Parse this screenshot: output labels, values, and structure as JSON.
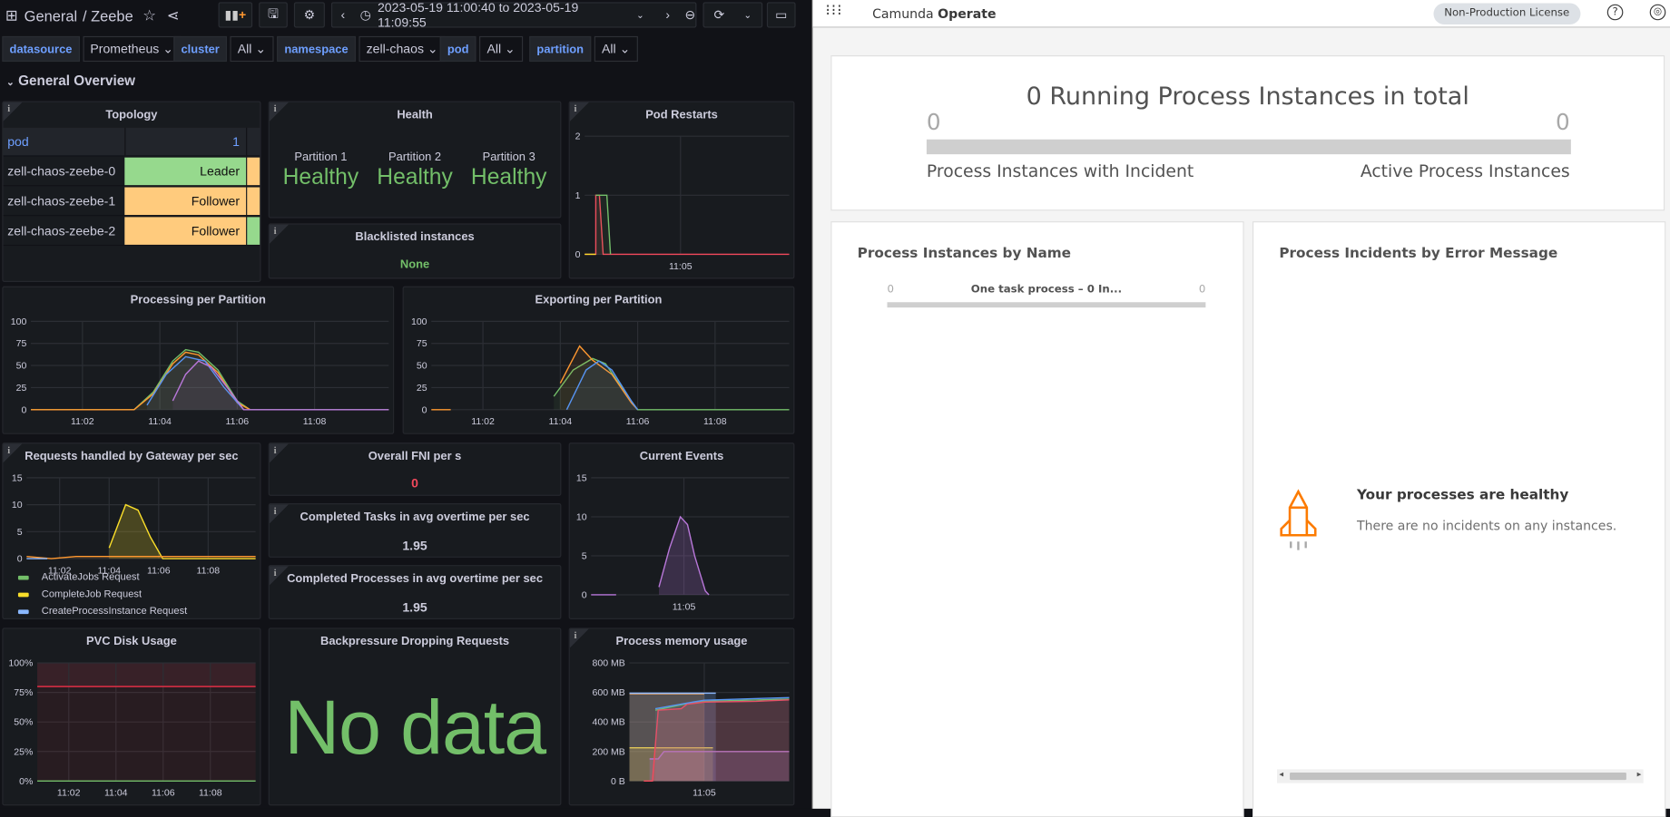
{
  "grafana": {
    "breadcrumb": {
      "folder": "General",
      "dashboard": "/ Zeebe"
    },
    "time_range": "2023-05-19 11:00:40 to 2023-05-19 11:09:55",
    "variables": [
      {
        "label": "datasource",
        "value": "Prometheus"
      },
      {
        "label": "cluster",
        "value": "All"
      },
      {
        "label": "namespace",
        "value": "zell-chaos"
      },
      {
        "label": "pod",
        "value": "All"
      },
      {
        "label": "partition",
        "value": "All"
      }
    ],
    "row_title": "General Overview",
    "topology": {
      "title": "Topology",
      "header": {
        "col1": "pod",
        "col2": "1"
      },
      "rows": [
        {
          "pod": "zell-chaos-zeebe-0",
          "role": "Leader",
          "role_color": "#96d98d",
          "extra_color": "#ffcb7d"
        },
        {
          "pod": "zell-chaos-zeebe-1",
          "role": "Follower",
          "role_color": "#ffcb7d",
          "extra_color": "#ffcb7d"
        },
        {
          "pod": "zell-chaos-zeebe-2",
          "role": "Follower",
          "role_color": "#ffcb7d",
          "extra_color": "#96d98d"
        }
      ]
    },
    "health": {
      "title": "Health",
      "partitions": [
        {
          "label": "Partition 1",
          "status": "Healthy"
        },
        {
          "label": "Partition 2",
          "status": "Healthy"
        },
        {
          "label": "Partition 3",
          "status": "Healthy"
        }
      ],
      "color": "#73bf69"
    },
    "blacklisted": {
      "title": "Blacklisted instances",
      "value": "None"
    },
    "fni": {
      "title": "Overall FNI per s",
      "value": "0",
      "color": "#f2495c"
    },
    "completed_tasks": {
      "title": "Completed Tasks in avg overtime per sec",
      "value": "1.95"
    },
    "completed_processes": {
      "title": "Completed Processes in avg overtime per sec",
      "value": "1.95"
    },
    "backpressure": {
      "title": "Backpressure Dropping Requests",
      "value": "No data"
    },
    "requests_legend": [
      {
        "name": "ActivateJobs Request",
        "color": "#73bf69"
      },
      {
        "name": "CompleteJob Request",
        "color": "#fade2a"
      },
      {
        "name": "CreateProcessInstance Request",
        "color": "#8ab8ff"
      }
    ]
  },
  "chart_data": [
    {
      "id": "pod_restarts",
      "title": "Pod Restarts",
      "type": "line",
      "xrange": [
        "11:00:40",
        "11:09:55"
      ],
      "ylim": [
        0,
        2
      ],
      "yticks": [
        "0",
        "1",
        "2"
      ],
      "ytick_values": [
        0,
        1,
        2
      ],
      "xticks": [
        "11:05"
      ],
      "series": [
        {
          "color": "#f2495c",
          "points": [
            [
              "11:00:40",
              0
            ],
            [
              "11:01:10",
              0
            ],
            [
              "11:01:10",
              1
            ],
            [
              "11:01:20",
              1
            ],
            [
              "11:01:30",
              0
            ],
            [
              "11:09:55",
              0
            ]
          ]
        },
        {
          "color": "#73bf69",
          "points": [
            [
              "11:01:10",
              1
            ],
            [
              "11:01:40",
              1
            ],
            [
              "11:01:50",
              0
            ]
          ]
        },
        {
          "color": "#fade2a",
          "points": [
            [
              "11:00:40",
              0
            ],
            [
              "11:01:10",
              0
            ]
          ]
        }
      ]
    },
    {
      "id": "processing",
      "title": "Processing per Partition",
      "type": "line",
      "xrange": [
        "11:00:40",
        "11:09:55"
      ],
      "ylim": [
        0,
        100
      ],
      "yticks": [
        "0",
        "25",
        "50",
        "75",
        "100"
      ],
      "ytick_values": [
        0,
        25,
        50,
        75,
        100
      ],
      "xticks": [
        "11:02",
        "11:04",
        "11:06",
        "11:08"
      ],
      "series": [
        {
          "color": "#73bf69",
          "points": [
            [
              "11:00:40",
              0
            ],
            [
              "11:03:20",
              0
            ],
            [
              "11:03:50",
              20
            ],
            [
              "11:04:20",
              55
            ],
            [
              "11:04:40",
              68
            ],
            [
              "11:05:00",
              65
            ],
            [
              "11:05:30",
              45
            ],
            [
              "11:06:00",
              10
            ],
            [
              "11:06:20",
              0
            ],
            [
              "11:09:55",
              0
            ]
          ]
        },
        {
          "color": "#ff9830",
          "points": [
            [
              "11:00:40",
              0
            ],
            [
              "11:03:20",
              0
            ],
            [
              "11:03:50",
              18
            ],
            [
              "11:04:20",
              52
            ],
            [
              "11:04:40",
              65
            ],
            [
              "11:05:00",
              62
            ],
            [
              "11:05:30",
              42
            ],
            [
              "11:06:00",
              8
            ],
            [
              "11:06:20",
              0
            ]
          ]
        },
        {
          "color": "#5794f2",
          "points": [
            [
              "11:03:40",
              5
            ],
            [
              "11:04:10",
              40
            ],
            [
              "11:04:40",
              60
            ],
            [
              "11:05:10",
              55
            ],
            [
              "11:05:40",
              25
            ],
            [
              "11:06:10",
              0
            ]
          ]
        },
        {
          "color": "#b877d9",
          "points": [
            [
              "11:04:20",
              10
            ],
            [
              "11:04:40",
              40
            ],
            [
              "11:05:00",
              55
            ],
            [
              "11:05:20",
              48
            ],
            [
              "11:05:50",
              20
            ],
            [
              "11:06:10",
              0
            ],
            [
              "11:09:55",
              0
            ]
          ]
        }
      ]
    },
    {
      "id": "exporting",
      "title": "Exporting per Partition",
      "type": "line",
      "xrange": [
        "11:00:40",
        "11:09:55"
      ],
      "ylim": [
        0,
        100
      ],
      "yticks": [
        "0",
        "25",
        "50",
        "75",
        "100"
      ],
      "ytick_values": [
        0,
        25,
        50,
        75,
        100
      ],
      "xticks": [
        "11:02",
        "11:04",
        "11:06",
        "11:08"
      ],
      "series": [
        {
          "color": "#ff9830",
          "points": [
            [
              "11:00:40",
              0
            ],
            [
              "11:01:10",
              0
            ]
          ]
        },
        {
          "color": "#73bf69",
          "points": [
            [
              "11:03:50",
              15
            ],
            [
              "11:04:20",
              45
            ],
            [
              "11:04:50",
              58
            ],
            [
              "11:05:10",
              52
            ],
            [
              "11:05:40",
              20
            ],
            [
              "11:06:00",
              0
            ],
            [
              "11:09:55",
              0
            ]
          ]
        },
        {
          "color": "#ff9830",
          "points": [
            [
              "11:04:00",
              30
            ],
            [
              "11:04:30",
              72
            ],
            [
              "11:04:50",
              56
            ],
            [
              "11:05:20",
              40
            ],
            [
              "11:05:50",
              8
            ],
            [
              "11:06:00",
              0
            ]
          ]
        },
        {
          "color": "#5794f2",
          "points": [
            [
              "11:04:10",
              0
            ],
            [
              "11:04:40",
              45
            ],
            [
              "11:05:00",
              55
            ],
            [
              "11:05:20",
              45
            ],
            [
              "11:05:50",
              10
            ],
            [
              "11:06:00",
              0
            ]
          ]
        }
      ]
    },
    {
      "id": "requests",
      "title": "Requests handled by Gateway per sec",
      "type": "line",
      "xrange": [
        "11:00:40",
        "11:09:55"
      ],
      "ylim": [
        0,
        15
      ],
      "yticks": [
        "0",
        "5",
        "10",
        "15"
      ],
      "ytick_values": [
        0,
        5,
        10,
        15
      ],
      "xticks": [
        "11:02",
        "11:04",
        "11:06",
        "11:08"
      ],
      "series": [
        {
          "color": "#fade2a",
          "fill": true,
          "points": [
            [
              "11:04:00",
              2
            ],
            [
              "11:04:40",
              10
            ],
            [
              "11:05:10",
              9
            ],
            [
              "11:05:40",
              4
            ],
            [
              "11:06:10",
              0
            ],
            [
              "11:09:55",
              0
            ]
          ]
        },
        {
          "color": "#ff9830",
          "points": [
            [
              "11:00:40",
              0.4
            ],
            [
              "11:01:40",
              0
            ],
            [
              "11:02:40",
              0.4
            ],
            [
              "11:09:55",
              0.4
            ]
          ]
        },
        {
          "color": "#8ab8ff",
          "points": [
            [
              "11:00:40",
              0
            ],
            [
              "11:01:30",
              0
            ]
          ]
        }
      ]
    },
    {
      "id": "current_events",
      "title": "Current Events",
      "type": "line",
      "xrange": [
        "11:00:40",
        "11:09:55"
      ],
      "ylim": [
        0,
        15
      ],
      "yticks": [
        "0",
        "5",
        "10",
        "15"
      ],
      "ytick_values": [
        0,
        5,
        10,
        15
      ],
      "xticks": [
        "11:05"
      ],
      "series": [
        {
          "color": "#b877d9",
          "points": [
            [
              "11:00:40",
              0
            ],
            [
              "11:01:50",
              0
            ]
          ]
        },
        {
          "color": "#b877d9",
          "fill": true,
          "points": [
            [
              "11:03:50",
              1
            ],
            [
              "11:04:20",
              6
            ],
            [
              "11:04:50",
              10
            ],
            [
              "11:05:10",
              9
            ],
            [
              "11:05:30",
              5
            ],
            [
              "11:06:00",
              0.5
            ],
            [
              "11:06:10",
              0
            ]
          ]
        }
      ]
    },
    {
      "id": "pvc",
      "title": "PVC Disk Usage",
      "type": "line",
      "xrange": [
        "11:00:40",
        "11:09:55"
      ],
      "ylim": [
        0,
        100
      ],
      "yticks": [
        "0%",
        "25%",
        "50%",
        "75%",
        "100%"
      ],
      "ytick_values": [
        0,
        25,
        50,
        75,
        100
      ],
      "xticks": [
        "11:02",
        "11:04",
        "11:06",
        "11:08"
      ],
      "threshold_band": {
        "from": 80,
        "to": 100,
        "color": "#f2495c"
      },
      "series": [
        {
          "color": "#e02f44",
          "points": [
            [
              "11:00:40",
              80
            ],
            [
              "11:09:55",
              80
            ]
          ]
        },
        {
          "color": "#73bf69",
          "points": [
            [
              "11:00:40",
              0
            ],
            [
              "11:09:55",
              0
            ]
          ]
        }
      ]
    },
    {
      "id": "memory",
      "title": "Process memory usage",
      "type": "line",
      "xrange": [
        "11:00:40",
        "11:09:55"
      ],
      "ylim": [
        0,
        800
      ],
      "yticks": [
        "0 B",
        "200 MB",
        "400 MB",
        "600 MB",
        "800 MB"
      ],
      "ytick_values": [
        0,
        200,
        400,
        600,
        800
      ],
      "xticks": [
        "11:05"
      ],
      "series": [
        {
          "color": "#fade2a",
          "fill": true,
          "points": [
            [
              "11:00:40",
              225
            ],
            [
              "11:05:30",
              225
            ]
          ]
        },
        {
          "color": "#ff9830",
          "fill": true,
          "points": [
            [
              "11:00:40",
              590
            ],
            [
              "11:05:00",
              590
            ]
          ]
        },
        {
          "color": "#8ab8ff",
          "fill": true,
          "points": [
            [
              "11:00:40",
              595
            ],
            [
              "11:05:40",
              595
            ]
          ]
        },
        {
          "color": "#b877d9",
          "fill": true,
          "points": [
            [
              "11:01:50",
              150
            ],
            [
              "11:02:20",
              150
            ],
            [
              "11:02:40",
              200
            ],
            [
              "11:09:55",
              200
            ]
          ]
        },
        {
          "color": "#73bf69",
          "points": [
            [
              "11:02:10",
              480
            ],
            [
              "11:03:50",
              520
            ],
            [
              "11:05:00",
              540
            ],
            [
              "11:09:55",
              555
            ]
          ]
        },
        {
          "color": "#f2495c",
          "fill": true,
          "points": [
            [
              "11:01:30",
              0
            ],
            [
              "11:02:00",
              0
            ],
            [
              "11:02:20",
              480
            ],
            [
              "11:03:40",
              490
            ],
            [
              "11:04:00",
              520
            ],
            [
              "11:05:00",
              535
            ],
            [
              "11:08:00",
              540
            ],
            [
              "11:09:55",
              550
            ]
          ]
        },
        {
          "color": "#5794f2",
          "points": [
            [
              "11:02:10",
              490
            ],
            [
              "11:03:50",
              525
            ],
            [
              "11:05:00",
              548
            ],
            [
              "11:08:20",
              560
            ],
            [
              "11:09:55",
              565
            ]
          ]
        }
      ]
    }
  ],
  "operate": {
    "brand": {
      "prefix": "Camunda",
      "name": "Operate"
    },
    "license": "Non-Production License",
    "summary": {
      "title": "0 Running Process Instances in total",
      "incident_count": "0",
      "active_count": "0",
      "incident_label": "Process Instances with Incident",
      "active_label": "Active Process Instances"
    },
    "by_name": {
      "title": "Process Instances by Name",
      "item": {
        "left": "0",
        "label": "One task process – 0 In...",
        "right": "0"
      }
    },
    "by_error": {
      "title": "Process Incidents by Error Message",
      "empty_title": "Your processes are healthy",
      "empty_text": "There are no incidents on any instances.",
      "icon_color": "#fc7b00"
    }
  }
}
